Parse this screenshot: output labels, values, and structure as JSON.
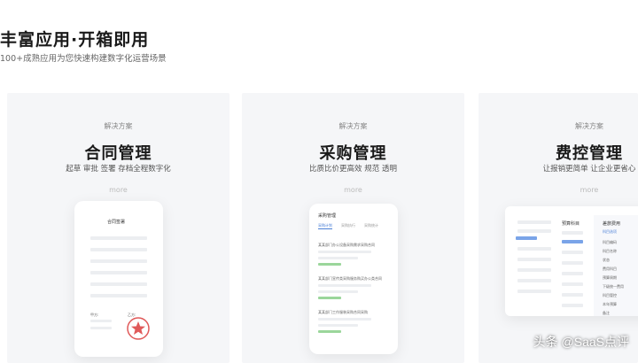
{
  "hero": {
    "title": "丰富应用·开箱即用",
    "subtitle": "100+成熟应用为您快速构建数字化运营场景"
  },
  "cards": [
    {
      "kicker": "解决方案",
      "title": "合同管理",
      "desc": "起草 审批 签署 存档全程数字化",
      "more": "more",
      "mock": {
        "header": "合同签署",
        "sign_a": "甲方:",
        "sign_b": "乙方:"
      }
    },
    {
      "kicker": "解决方案",
      "title": "采购管理",
      "desc": "比质比价更高效 规范 透明",
      "more": "more",
      "mock": {
        "header": "采购管理",
        "tabs": [
          "采购计划",
          "采购执行",
          "采购统计"
        ],
        "items": [
          "某某部门办公设备采购需求采购合同",
          "某某部门宣传类采购服务购买办公类合同",
          "某某部门工作服装采购合同采购"
        ]
      }
    },
    {
      "kicker": "解决方案",
      "title": "费控管理",
      "desc": "让报销更简单 让企业更省心",
      "more": "more",
      "mock": {
        "col1": "预算科目",
        "col2": "差旅费用",
        "rows": [
          "科目选项",
          "科目编码",
          "科目名称",
          "状态",
          "费用科目",
          "预算周期",
          "下级统一费用",
          "科目管控",
          "本年预算",
          "备注"
        ]
      }
    }
  ],
  "watermark": "头条 @SaaS点评"
}
